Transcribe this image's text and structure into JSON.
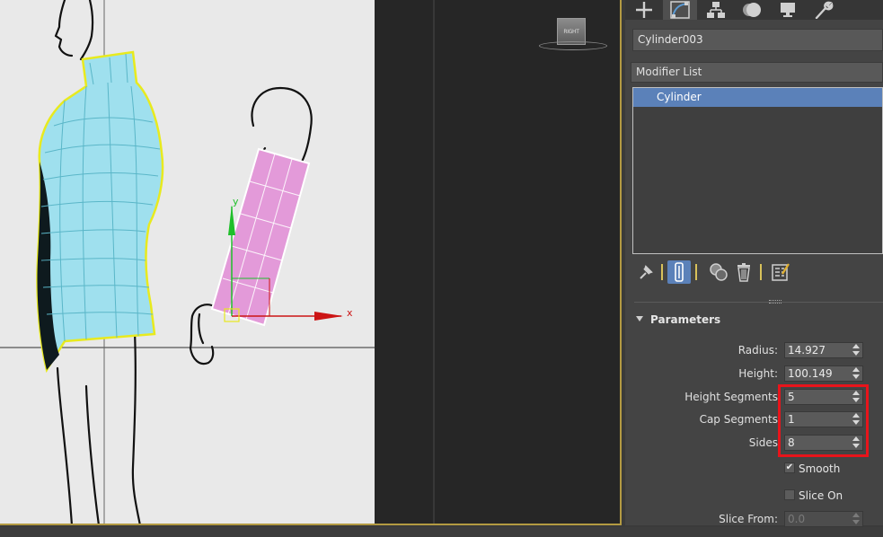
{
  "viewport": {
    "viewcube_label": "RIGHT",
    "gizmo_x_label": "x",
    "gizmo_y_label": "y"
  },
  "command_panel": {
    "tabs": [
      {
        "name": "create",
        "icon": "plus-icon"
      },
      {
        "name": "modify",
        "icon": "modify-curve-icon",
        "active": true
      },
      {
        "name": "hierarchy",
        "icon": "hierarchy-icon"
      },
      {
        "name": "motion",
        "icon": "motion-icon"
      },
      {
        "name": "display",
        "icon": "display-monitor-icon"
      },
      {
        "name": "utilities",
        "icon": "wrench-icon"
      }
    ],
    "object_name": "Cylinder003",
    "modifier_list_label": "Modifier List",
    "modifier_stack": [
      "Cylinder"
    ],
    "parameters": {
      "header": "Parameters",
      "radius_label": "Radius:",
      "radius_value": "14.927",
      "height_label": "Height:",
      "height_value": "100.149",
      "height_segments_label": "Height Segments",
      "height_segments_value": "5",
      "cap_segments_label": "Cap Segments",
      "cap_segments_value": "1",
      "sides_label": "Sides",
      "sides_value": "8",
      "smooth_label": "Smooth",
      "smooth_checked": true,
      "slice_on_label": "Slice On",
      "slice_on_checked": false,
      "slice_from_label": "Slice From:",
      "slice_from_value": "0.0"
    }
  },
  "colors": {
    "selection_blue": "#5b81b9",
    "highlight_red": "#e8141b",
    "viewport_border": "#b39a42",
    "torso_mesh": "#9fe0ee",
    "arm_cylinder": "#e39ad9"
  }
}
